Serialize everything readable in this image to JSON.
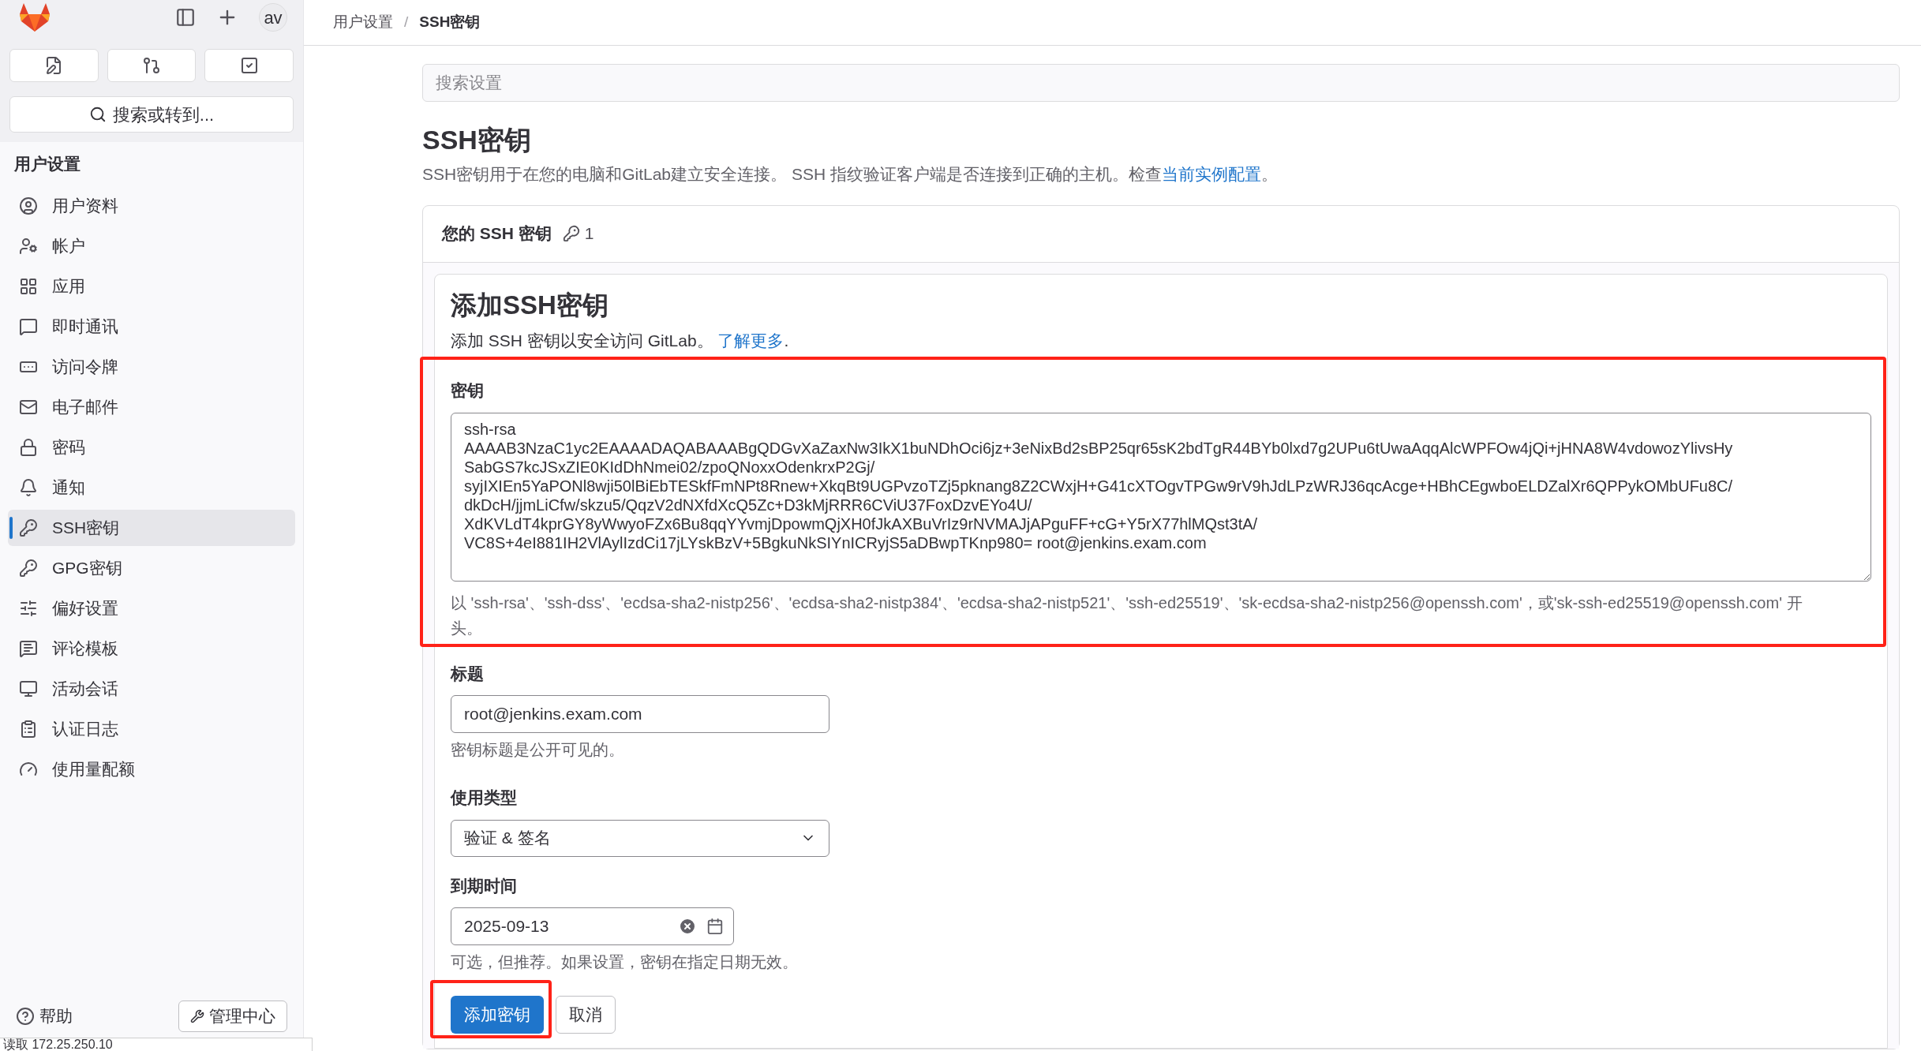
{
  "sidebar": {
    "avatar": "av",
    "search": "搜索或转到...",
    "heading": "用户设置",
    "items": [
      {
        "label": "用户资料",
        "selected": false
      },
      {
        "label": "帐户",
        "selected": false
      },
      {
        "label": "应用",
        "selected": false
      },
      {
        "label": "即时通讯",
        "selected": false
      },
      {
        "label": "访问令牌",
        "selected": false
      },
      {
        "label": "电子邮件",
        "selected": false
      },
      {
        "label": "密码",
        "selected": false
      },
      {
        "label": "通知",
        "selected": false
      },
      {
        "label": "SSH密钥",
        "selected": true
      },
      {
        "label": "GPG密钥",
        "selected": false
      },
      {
        "label": "偏好设置",
        "selected": false
      },
      {
        "label": "评论模板",
        "selected": false
      },
      {
        "label": "活动会话",
        "selected": false
      },
      {
        "label": "认证日志",
        "selected": false
      },
      {
        "label": "使用量配额",
        "selected": false
      }
    ],
    "help": "帮助",
    "admin": "管理中心"
  },
  "breadcrumb": [
    "用户设置",
    "SSH密钥"
  ],
  "breadcrumb_separator": "/",
  "search_settings": {
    "placeholder": "搜索设置"
  },
  "page_title": "SSH密钥",
  "description": {
    "text": "SSH密钥用于在您的电脑和GitLab建立安全连接。 SSH 指纹验证客户端是否连接到正确的主机。检查",
    "link": "当前实例配置",
    "end": "。"
  },
  "keys_card": {
    "title": "您的 SSH 密钥",
    "count": "1"
  },
  "add_form": {
    "title": "添加SSH密钥",
    "intro": "添加 SSH 密钥以安全访问 GitLab。",
    "intro_link": "了解更多",
    "intro_end": ".",
    "key_label": "密钥",
    "key_value": "ssh-rsa\nAAAAB3NzaC1yc2EAAAADAQABAAABgQDGvXaZaxNw3IkX1buNDhOci6jz+3eNixBd2sBP25qr65sK2bdTgR44BYb0lxd7g2UPu6tUwaAqqAlcWPFOw4jQi+jHNA8W4vdowozYlivsHy\nSabGS7kcJSxZIE0KIdDhNmei02/zpoQNoxxOdenkrxP2Gj/\nsyjIXIEn5YaPONl8wji50lBiEbTESkfFmNPt8Rnew+XkqBt9UGPvzoTZj5pknang8Z2CWxjH+G41cXTOgvTPGw9rV9hJdLPzWRJ36qcAcge+HBhCEgwboELDZalXr6QPPykOMbUFu8C/\ndkDcH/jjmLiCfw/skzu5/QqzV2dNXfdXcQ5Zc+D3kMjRRR6CViU37FoxDzvEYo4U/\nXdKVLdT4kprGY8yWwyoFZx6Bu8qqYYvmjDpowmQjXH0fJkAXBuVrIz9rNVMAJjAPguFF+cG+Y5rX77hlMQst3tA/\nVC8S+4eI881IH2VlAylIzdCi17jLYskBzV+5BgkuNkSIYnICRyjS5aDBwpTKnp980= root@jenkins.exam.com",
    "key_hint": "以 'ssh-rsa'、'ssh-dss'、'ecdsa-sha2-nistp256'、'ecdsa-sha2-nistp384'、'ecdsa-sha2-nistp521'、'ssh-ed25519'、'sk-ecdsa-sha2-nistp256@openssh.com'，或'sk-ssh-ed25519@openssh.com' 开头。",
    "title_label": "标题",
    "title_value": "root@jenkins.exam.com",
    "title_hint": "密钥标题是公开可见的。",
    "usage_label": "使用类型",
    "usage_value": "验证 & 签名",
    "expiry_label": "到期时间",
    "expiry_value": "2025-09-13",
    "expiry_hint": "可选，但推荐。如果设置，密钥在指定日期无效。",
    "submit": "添加密钥",
    "cancel": "取消"
  },
  "status_bar": "读取 172.25.250.10"
}
